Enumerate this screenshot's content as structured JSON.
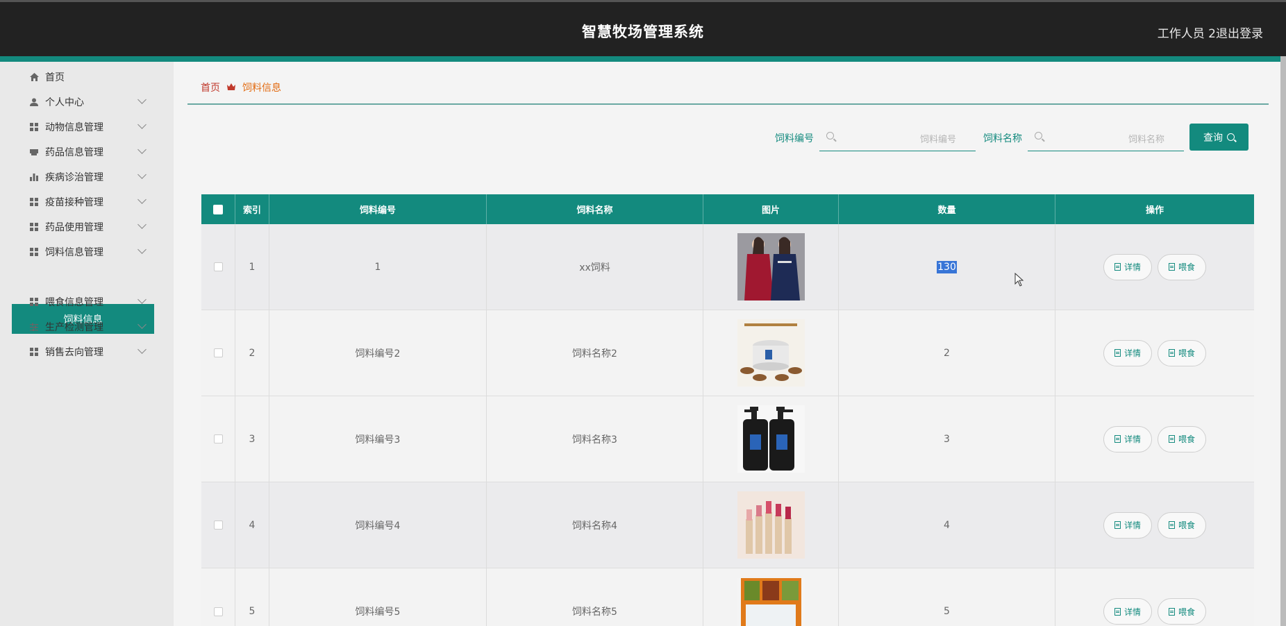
{
  "header": {
    "title": "智慧牧场管理系统",
    "user": "工作人员 2",
    "logout": "退出登录"
  },
  "sidebar": {
    "items": [
      {
        "label": "首页",
        "icon": "home-icon"
      },
      {
        "label": "个人中心",
        "icon": "user-icon"
      },
      {
        "label": "动物信息管理",
        "icon": "grid-icon"
      },
      {
        "label": "药品信息管理",
        "icon": "printer-icon"
      },
      {
        "label": "疾病诊治管理",
        "icon": "bar-chart-icon"
      },
      {
        "label": "疫苗接种管理",
        "icon": "grid-icon"
      },
      {
        "label": "药品使用管理",
        "icon": "grid-icon"
      },
      {
        "label": "饲料信息管理",
        "icon": "grid-icon"
      },
      {
        "label": "喂食信息管理",
        "icon": "grid-icon"
      },
      {
        "label": "生产检测管理",
        "icon": "sliders-icon"
      },
      {
        "label": "销售去向管理",
        "icon": "grid-icon"
      }
    ],
    "active_sub": "饲料信息"
  },
  "breadcrumb": {
    "home": "首页",
    "current": "饲料信息"
  },
  "search": {
    "code_label": "饲料编号",
    "code_placeholder": "饲料编号",
    "name_label": "饲料名称",
    "name_placeholder": "饲料名称",
    "query_button": "查询"
  },
  "table": {
    "headers": {
      "index": "索引",
      "code": "饲料编号",
      "name": "饲料名称",
      "image": "图片",
      "quantity": "数量",
      "actions": "操作"
    },
    "rows": [
      {
        "index": "1",
        "code": "1",
        "name": "xx饲料",
        "image": "product-photo-women-dresses",
        "quantity": "130"
      },
      {
        "index": "2",
        "code": "饲料编号2",
        "name": "饲料名称2",
        "image": "product-photo-rice-cooker",
        "quantity": "2"
      },
      {
        "index": "3",
        "code": "饲料编号3",
        "name": "饲料名称3",
        "image": "product-photo-cleanser-bottles",
        "quantity": "3"
      },
      {
        "index": "4",
        "code": "饲料编号4",
        "name": "饲料名称4",
        "image": "product-photo-lipsticks",
        "quantity": "4"
      },
      {
        "index": "5",
        "code": "饲料编号5",
        "name": "饲料名称5",
        "image": "product-photo-food-box",
        "quantity": "5"
      }
    ],
    "action_detail": "详情",
    "action_feed": "喂食"
  },
  "colors": {
    "primary": "#138a7e",
    "header_bg": "#222222",
    "sidebar_bg": "#e9e9e9",
    "breadcrumb_current": "#e26a10"
  }
}
